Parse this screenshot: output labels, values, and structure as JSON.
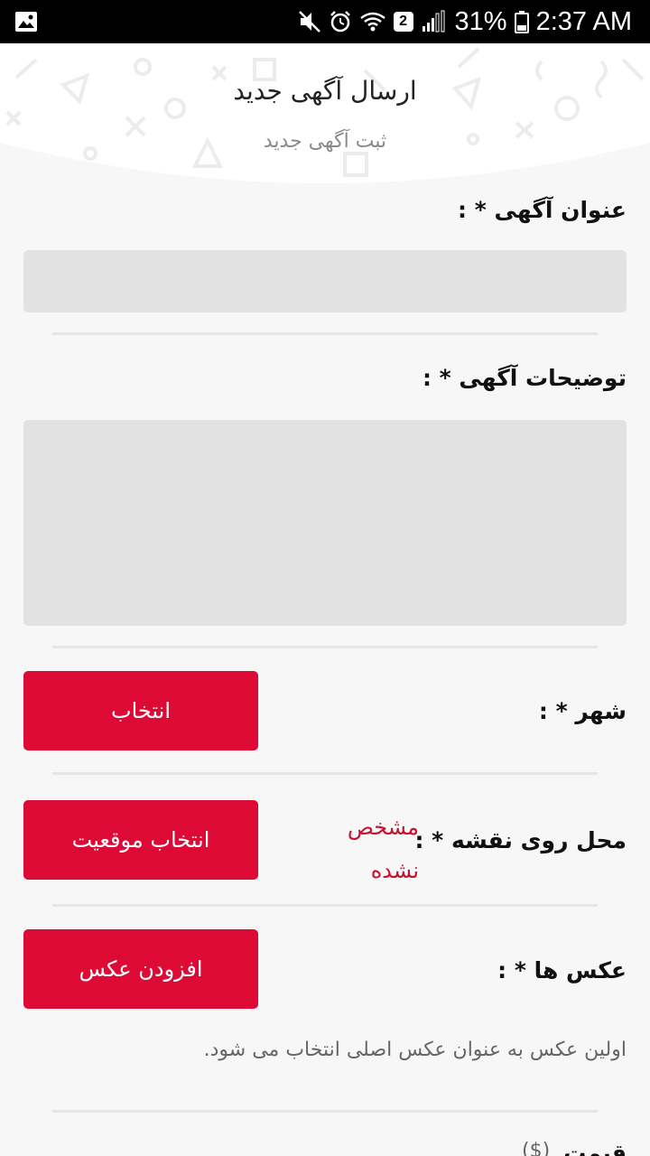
{
  "status_bar": {
    "time": "2:37 AM",
    "battery": "31%",
    "sim_badge": "2"
  },
  "header": {
    "title": "ارسال آگهی جدید",
    "subtitle": "ثبت آگهی جدید",
    "accent_color": "#dc0a35"
  },
  "form": {
    "title_field": {
      "label": "عنوان آگهی * :",
      "value": ""
    },
    "description_field": {
      "label": "توضیحات آگهی * :",
      "value": ""
    },
    "city": {
      "label": "شهر * :",
      "button": "انتخاب"
    },
    "map_location": {
      "label": "محل روی نقشه * :",
      "status": "مشخص نشده",
      "button": "انتخاب موقعیت"
    },
    "photos": {
      "label": "عکس ها * :",
      "button": "افزودن عکس",
      "hint": "اولین عکس به عنوان عکس اصلی انتخاب می شود."
    },
    "price": {
      "label": "قیمت",
      "unit": "($)"
    }
  }
}
